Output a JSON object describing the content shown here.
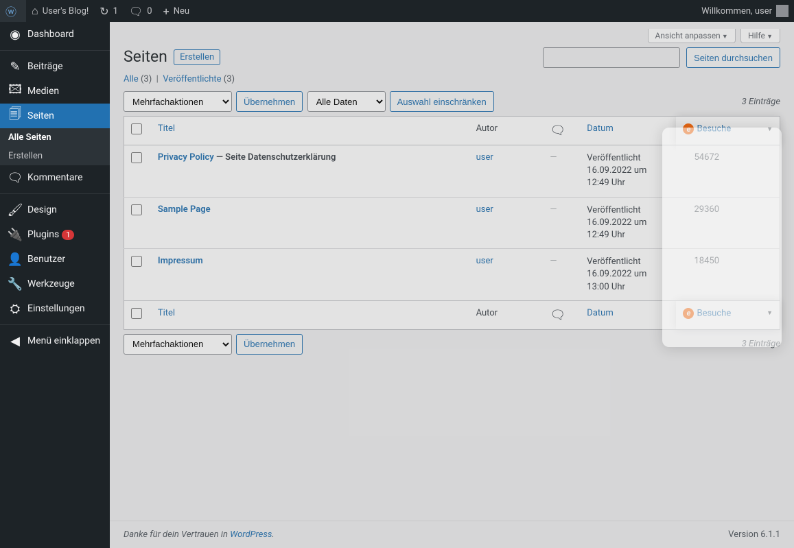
{
  "adminbar": {
    "site_name": "User's Blog!",
    "updates": "1",
    "comments": "0",
    "new": "Neu",
    "welcome": "Willkommen, user"
  },
  "sidebar": {
    "dashboard": "Dashboard",
    "posts": "Beiträge",
    "media": "Medien",
    "pages": "Seiten",
    "all_pages": "Alle Seiten",
    "add_new": "Erstellen",
    "comments": "Kommentare",
    "design": "Design",
    "plugins": "Plugins",
    "plugins_badge": "1",
    "users": "Benutzer",
    "tools": "Werkzeuge",
    "settings": "Einstellungen",
    "collapse": "Menü einklappen"
  },
  "screen": {
    "options": "Ansicht anpassen",
    "help": "Hilfe"
  },
  "heading": "Seiten",
  "add_new_btn": "Erstellen",
  "filters": {
    "all": "Alle",
    "all_count": "(3)",
    "published": "Veröffentlichte",
    "published_count": "(3)"
  },
  "search": {
    "button": "Seiten durchsuchen"
  },
  "bulk": {
    "actions": "Mehrfachaktionen",
    "apply": "Übernehmen",
    "all_dates": "Alle Daten",
    "filter": "Auswahl einschränken"
  },
  "count_label": "3 Einträge",
  "columns": {
    "title": "Titel",
    "author": "Autor",
    "date": "Datum",
    "visits": "Besuche"
  },
  "rows": [
    {
      "title": "Privacy Policy",
      "state": "— Seite Datenschutzerklärung",
      "author": "user",
      "comments": "—",
      "status": "Veröffentlicht",
      "date": "16.09.2022 um 12:49 Uhr",
      "visits": "54672"
    },
    {
      "title": "Sample Page",
      "state": "",
      "author": "user",
      "comments": "—",
      "status": "Veröffentlicht",
      "date": "16.09.2022 um 12:49 Uhr",
      "visits": "29360"
    },
    {
      "title": "Impressum",
      "state": "",
      "author": "user",
      "comments": "—",
      "status": "Veröffentlicht",
      "date": "16.09.2022 um 13:00 Uhr",
      "visits": "18450"
    }
  ],
  "footer": {
    "thanks_pre": "Danke für dein Vertrauen in ",
    "wp": "WordPress",
    "thanks_post": ".",
    "version": "Version 6.1.1"
  }
}
